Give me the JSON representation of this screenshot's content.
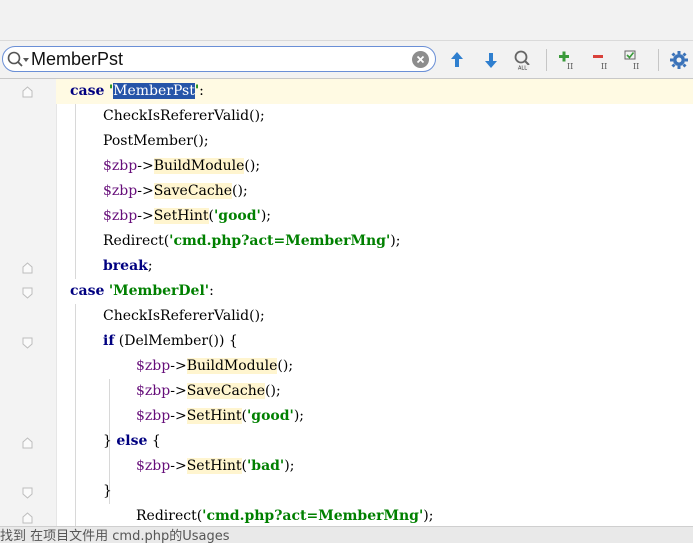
{
  "search": {
    "query": "MemberPst"
  },
  "toolbar": {
    "icons": [
      "search-options-icon",
      "clear-icon",
      "previous-occurrence-icon",
      "next-occurrence-icon",
      "find-all-icon",
      "add-occurrence-icon",
      "remove-occurrence-icon",
      "select-all-occurrences-icon",
      "settings-icon"
    ]
  },
  "code": [
    {
      "tokens": [
        [
          "kw",
          "case"
        ],
        [
          "",
          "",
          " "
        ],
        [
          "str",
          "'"
        ],
        [
          "sel",
          "MemberPst"
        ],
        [
          "str",
          "'"
        ],
        [
          "",
          ":"
        ]
      ]
    },
    {
      "tokens": [
        [
          "",
          "CheckIsRefererValid();"
        ]
      ]
    },
    {
      "tokens": [
        [
          "",
          "PostMember();"
        ]
      ]
    },
    {
      "tokens": [
        [
          "var",
          "$zbp"
        ],
        [
          "arrow",
          "->"
        ],
        [
          "mcall",
          "BuildModule"
        ],
        [
          "",
          "();"
        ]
      ]
    },
    {
      "tokens": [
        [
          "var",
          "$zbp"
        ],
        [
          "arrow",
          "->"
        ],
        [
          "mcall",
          "SaveCache"
        ],
        [
          "",
          "();"
        ]
      ]
    },
    {
      "tokens": [
        [
          "var",
          "$zbp"
        ],
        [
          "arrow",
          "->"
        ],
        [
          "mcall",
          "SetHint"
        ],
        [
          "",
          "("
        ],
        [
          "str",
          "'good'"
        ],
        [
          "",
          ");"
        ]
      ]
    },
    {
      "tokens": [
        [
          "",
          "Redirect("
        ],
        [
          "str",
          "'cmd.php?act=MemberMng'"
        ],
        [
          "",
          ");"
        ]
      ]
    },
    {
      "tokens": [
        [
          "kw",
          "break"
        ],
        [
          "",
          ";"
        ]
      ]
    },
    {
      "tokens": [
        [
          "kw",
          "case"
        ],
        [
          "",
          " "
        ],
        [
          "str",
          "'MemberDel'"
        ],
        [
          "",
          ":"
        ]
      ]
    },
    {
      "tokens": [
        [
          "",
          "CheckIsRefererValid();"
        ]
      ]
    },
    {
      "tokens": [
        [
          "kw",
          "if"
        ],
        [
          "",
          " (DelMember()) {"
        ]
      ]
    },
    {
      "tokens": [
        [
          "var",
          "$zbp"
        ],
        [
          "arrow",
          "->"
        ],
        [
          "mcall",
          "BuildModule"
        ],
        [
          "",
          "();"
        ]
      ]
    },
    {
      "tokens": [
        [
          "var",
          "$zbp"
        ],
        [
          "arrow",
          "->"
        ],
        [
          "mcall",
          "SaveCache"
        ],
        [
          "",
          "();"
        ]
      ]
    },
    {
      "tokens": [
        [
          "var",
          "$zbp"
        ],
        [
          "arrow",
          "->"
        ],
        [
          "mcall",
          "SetHint"
        ],
        [
          "",
          "("
        ],
        [
          "str",
          "'good'"
        ],
        [
          "",
          ");"
        ]
      ]
    },
    {
      "tokens": [
        [
          "",
          "} "
        ],
        [
          "kw",
          "else"
        ],
        [
          "",
          " {"
        ]
      ]
    },
    {
      "tokens": [
        [
          "var",
          "$zbp"
        ],
        [
          "arrow",
          "->"
        ],
        [
          "mcall",
          "SetHint"
        ],
        [
          "",
          "("
        ],
        [
          "str",
          "'bad'"
        ],
        [
          "",
          ");"
        ]
      ]
    },
    {
      "tokens": [
        [
          "",
          "}"
        ]
      ]
    },
    {
      "tokens": [
        [
          "",
          "Redirect("
        ],
        [
          "str",
          "'cmd.php?act=MemberMng'"
        ],
        [
          "",
          ");"
        ]
      ]
    }
  ],
  "status": {
    "text": "找到 在项目文件用 cmd.php的Usages"
  }
}
